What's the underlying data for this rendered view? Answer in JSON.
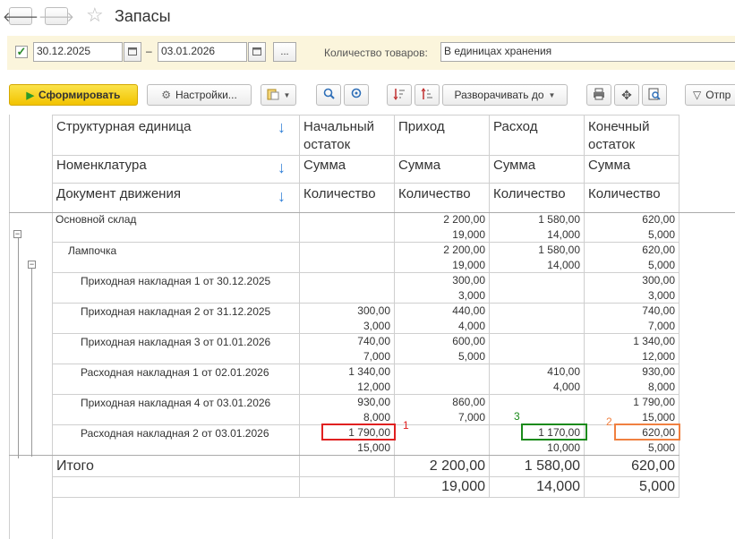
{
  "title": "Запасы",
  "nav": {
    "back_icon": "arrow-left-icon",
    "forward_icon": "arrow-right-icon",
    "star_icon": "star-icon"
  },
  "filter": {
    "period_checked": true,
    "date_from": "30.12.2025",
    "dash": "–",
    "date_to": "03.01.2026",
    "more_label": "...",
    "qty_label": "Количество товаров:",
    "qty_value": "В единицах хранения"
  },
  "toolbar": {
    "generate_label": "Сформировать",
    "settings_label": "Настройки...",
    "expand_label": "Разворачивать до",
    "send_label": "Отпр"
  },
  "headers": {
    "row1": "Структурная единица",
    "row2": "Номенклатура",
    "row3": "Документ движения",
    "col_begin": "Начальный остаток",
    "col_in": "Приход",
    "col_out": "Расход",
    "col_end": "Конечный остаток",
    "sum": "Сумма",
    "qty": "Количество"
  },
  "rows": [
    {
      "label": "Основной склад",
      "begin": [
        "",
        ""
      ],
      "in": [
        "2 200,00",
        "19,000"
      ],
      "out": [
        "1 580,00",
        "14,000"
      ],
      "end": [
        "620,00",
        "5,000"
      ]
    },
    {
      "label": "Лампочка",
      "begin": [
        "",
        ""
      ],
      "in": [
        "2 200,00",
        "19,000"
      ],
      "out": [
        "1 580,00",
        "14,000"
      ],
      "end": [
        "620,00",
        "5,000"
      ]
    },
    {
      "label": "Приходная накладная 1 от 30.12.2025",
      "begin": [
        "",
        ""
      ],
      "in": [
        "300,00",
        "3,000"
      ],
      "out": [
        "",
        ""
      ],
      "end": [
        "300,00",
        "3,000"
      ]
    },
    {
      "label": "Приходная накладная 2 от 31.12.2025",
      "begin": [
        "300,00",
        "3,000"
      ],
      "in": [
        "440,00",
        "4,000"
      ],
      "out": [
        "",
        ""
      ],
      "end": [
        "740,00",
        "7,000"
      ]
    },
    {
      "label": "Приходная накладная 3 от 01.01.2026",
      "begin": [
        "740,00",
        "7,000"
      ],
      "in": [
        "600,00",
        "5,000"
      ],
      "out": [
        "",
        ""
      ],
      "end": [
        "1 340,00",
        "12,000"
      ]
    },
    {
      "label": "Расходная накладная 1 от 02.01.2026",
      "begin": [
        "1 340,00",
        "12,000"
      ],
      "in": [
        "",
        ""
      ],
      "out": [
        "410,00",
        "4,000"
      ],
      "end": [
        "930,00",
        "8,000"
      ]
    },
    {
      "label": "Приходная накладная 4 от 03.01.2026",
      "begin": [
        "930,00",
        "8,000"
      ],
      "in": [
        "860,00",
        "7,000"
      ],
      "out": [
        "",
        ""
      ],
      "end": [
        "1 790,00",
        "15,000"
      ]
    },
    {
      "label": "Расходная накладная 2 от 03.01.2026",
      "begin": [
        "1 790,00",
        "15,000"
      ],
      "in": [
        "",
        ""
      ],
      "out": [
        "1 170,00",
        "10,000"
      ],
      "end": [
        "620,00",
        "5,000"
      ]
    }
  ],
  "total": {
    "label": "Итого",
    "in": [
      "2 200,00",
      "19,000"
    ],
    "out": [
      "1 580,00",
      "14,000"
    ],
    "end": [
      "620,00",
      "5,000"
    ]
  },
  "marks": {
    "m1": "1",
    "m2": "2",
    "m3": "3"
  },
  "colors": {
    "mark1": "#e02020",
    "mark2": "#f08040",
    "mark3": "#1a8a1a",
    "accent": "#f2c300"
  }
}
